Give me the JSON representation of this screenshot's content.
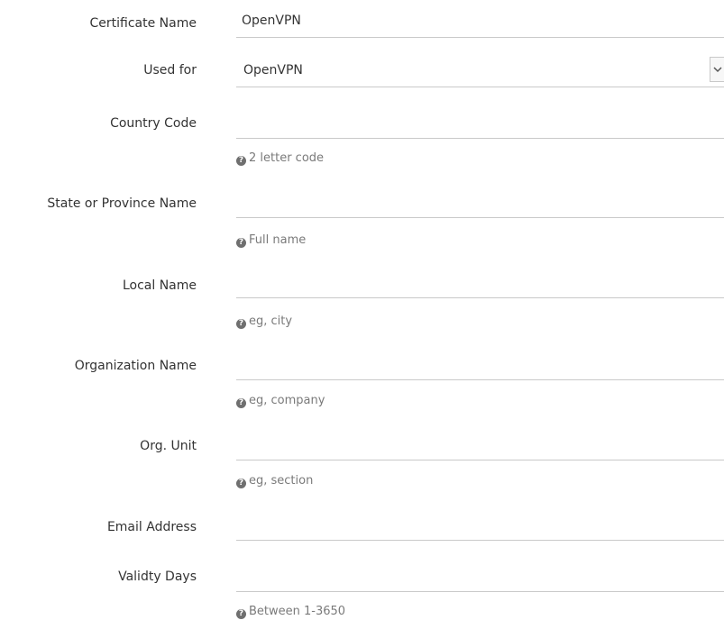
{
  "form": {
    "certificate_name": {
      "label": "Certificate Name",
      "value": "OpenVPN"
    },
    "used_for": {
      "label": "Used for",
      "value": "OpenVPN"
    },
    "country_code": {
      "label": "Country Code",
      "value": "",
      "hint": "2 letter code"
    },
    "state_province": {
      "label": "State or Province Name",
      "value": "",
      "hint": "Full name"
    },
    "local_name": {
      "label": "Local Name",
      "value": "",
      "hint": "eg, city"
    },
    "organization_name": {
      "label": "Organization Name",
      "value": "",
      "hint": "eg, company"
    },
    "org_unit": {
      "label": "Org. Unit",
      "value": "",
      "hint": "eg, section"
    },
    "email_address": {
      "label": "Email Address",
      "value": ""
    },
    "validity_days": {
      "label": "Validty Days",
      "value": "",
      "hint": "Between 1-3650"
    }
  },
  "icons": {
    "hint_icon": "question-circle-icon",
    "select_icon": "chevron-down-icon"
  },
  "colors": {
    "text": "#333333",
    "hint": "#7a7a7a",
    "underline": "#c9c9c9"
  }
}
